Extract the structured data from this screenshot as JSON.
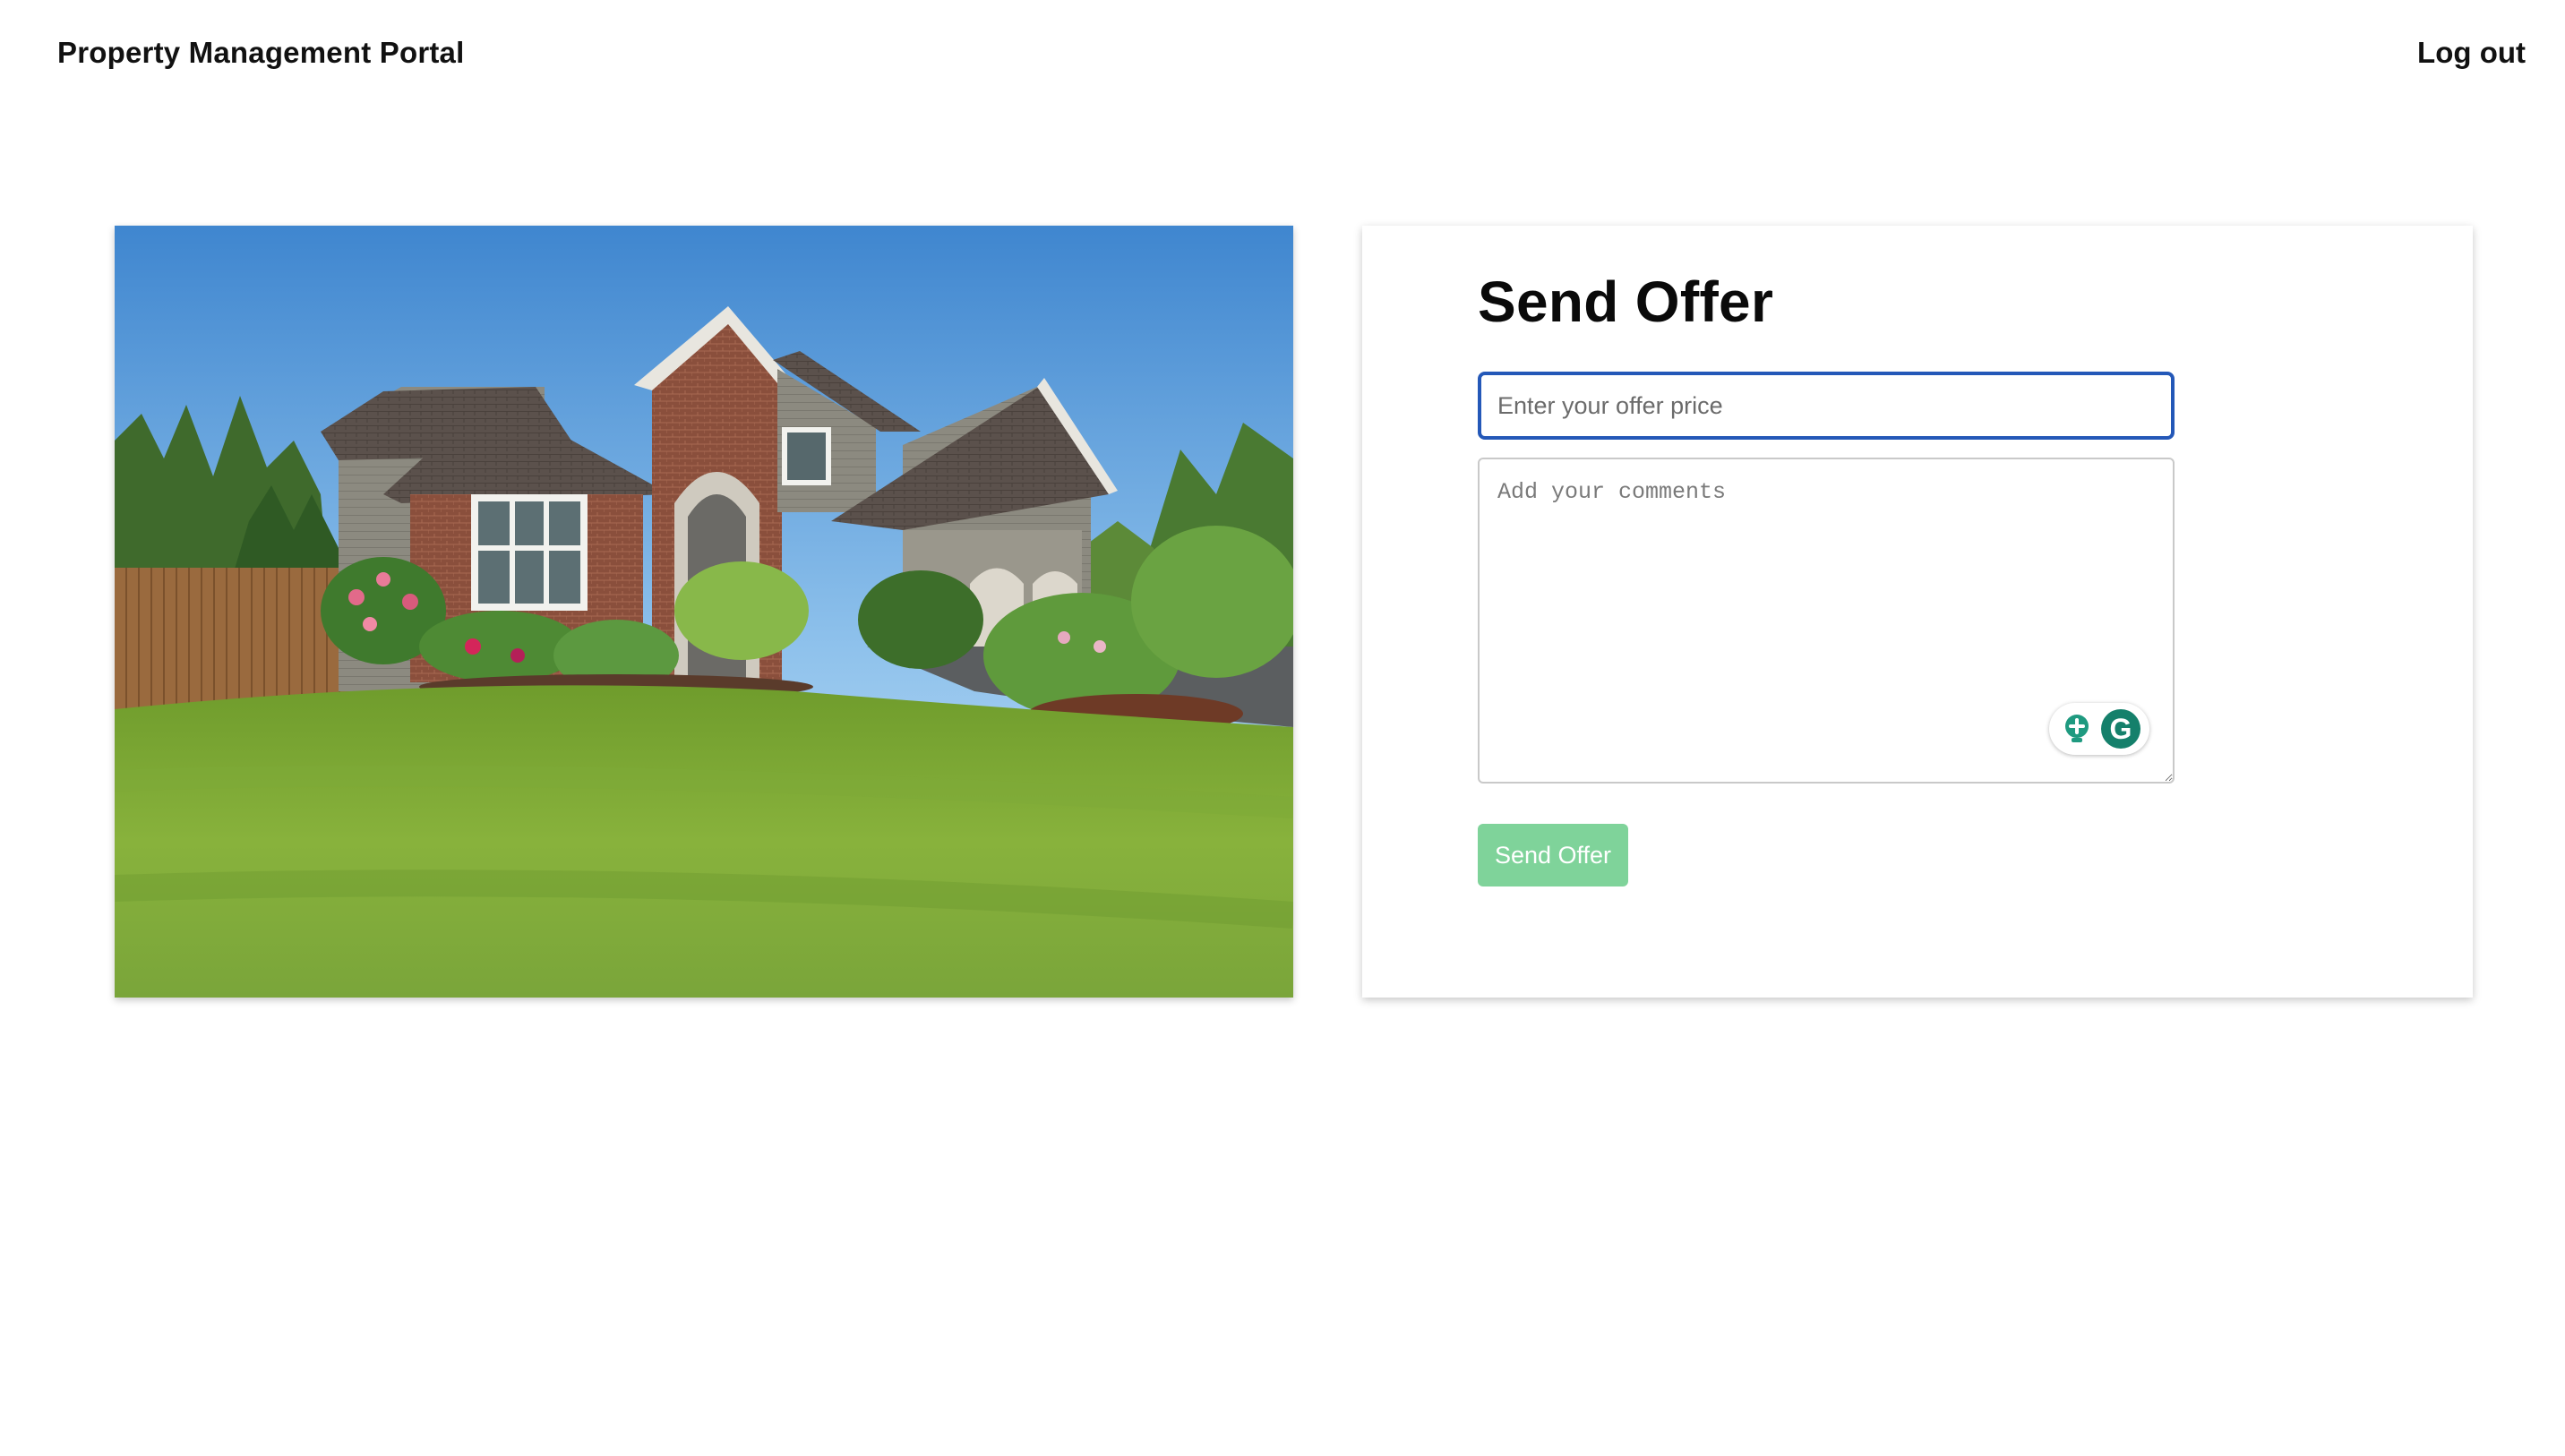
{
  "header": {
    "brand": "Property Management Portal",
    "logout_label": "Log out"
  },
  "listing_image": {
    "alt": "House with lawn"
  },
  "offer_form": {
    "title": "Send Offer",
    "price_placeholder": "Enter your offer price",
    "price_value": "",
    "comments_placeholder": "Add your comments",
    "comments_value": "",
    "submit_label": "Send Offer",
    "assistant_icons": [
      "lightbulb-icon",
      "grammarly-icon"
    ],
    "assistant_letter": "G"
  },
  "colors": {
    "input_focus_border": "#2458b8",
    "submit_button": "#7fd39a",
    "assistant_green": "#15806b"
  }
}
